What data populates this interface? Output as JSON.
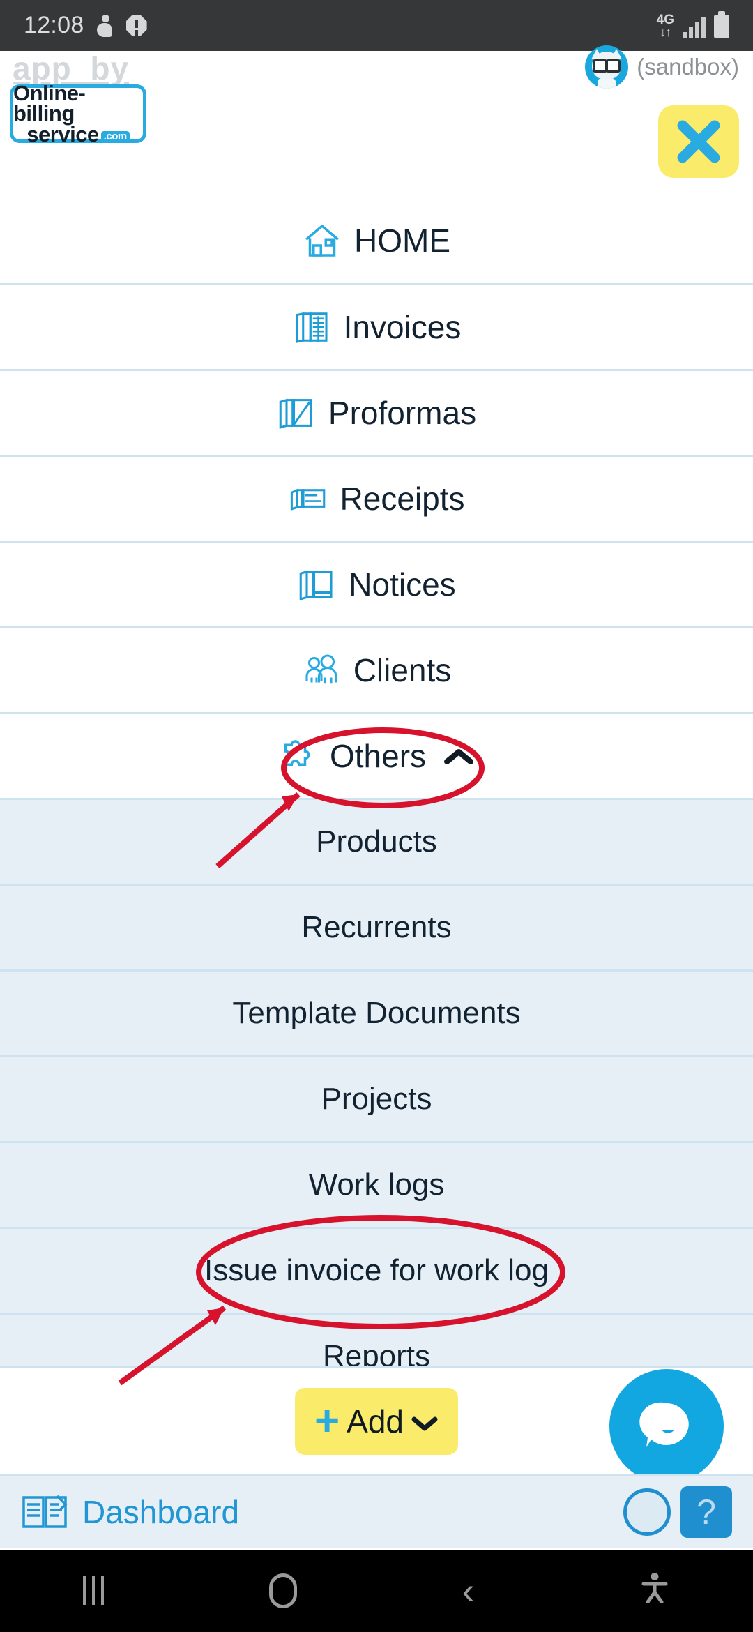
{
  "status_bar": {
    "time": "12:08",
    "network_type": "4G",
    "icons": [
      "person-icon",
      "alert-icon",
      "data-arrows-icon",
      "signal-bars-icon",
      "battery-icon"
    ]
  },
  "header": {
    "app_by_label": "app_by",
    "sandbox_label": "(sandbox)",
    "logo": {
      "line1": "Online-billing",
      "line2": "service",
      "domain": ".com"
    },
    "close_label": "✕"
  },
  "menu": {
    "items": [
      {
        "label": "HOME",
        "icon": "home-icon",
        "type": "top"
      },
      {
        "label": "Invoices",
        "icon": "invoices-icon",
        "type": "top"
      },
      {
        "label": "Proformas",
        "icon": "proformas-icon",
        "type": "top"
      },
      {
        "label": "Receipts",
        "icon": "receipts-icon",
        "type": "top"
      },
      {
        "label": "Notices",
        "icon": "notices-icon",
        "type": "top"
      },
      {
        "label": "Clients",
        "icon": "clients-icon",
        "type": "top"
      },
      {
        "label": "Others",
        "icon": "puzzle-icon",
        "type": "expandable",
        "expanded": true,
        "chevron": "chevron-up-icon"
      },
      {
        "label": "Products",
        "type": "sub"
      },
      {
        "label": "Recurrents",
        "type": "sub"
      },
      {
        "label": "Template Documents",
        "type": "sub"
      },
      {
        "label": "Projects",
        "type": "sub"
      },
      {
        "label": "Work logs",
        "type": "sub"
      },
      {
        "label": "Issue invoice for work log",
        "type": "sub"
      },
      {
        "label": "Reports",
        "type": "sub"
      }
    ]
  },
  "footer": {
    "add_label": "Add",
    "add_plus": "+",
    "add_chevron": "chevron-down-icon",
    "chat_icon": "chat-bubble-icon",
    "dashboard_label": "Dashboard",
    "dashboard_icon": "dashboard-book-icon",
    "help_label": "?"
  },
  "navigation_bar": {
    "recents": "recents-icon",
    "home": "home-circle-icon",
    "back": "‹",
    "accessibility": "accessibility-icon"
  },
  "annotations": {
    "color": "#d6122c",
    "highlight_1": "Others",
    "highlight_2": "Issue invoice for work log"
  },
  "colors": {
    "accent_cyan": "#29abe2",
    "accent_yellow": "#faec6a",
    "sub_bg": "#e7eff6",
    "divider": "#cfe2ef",
    "text_dark": "#122231",
    "annotation_red": "#d6122c"
  }
}
